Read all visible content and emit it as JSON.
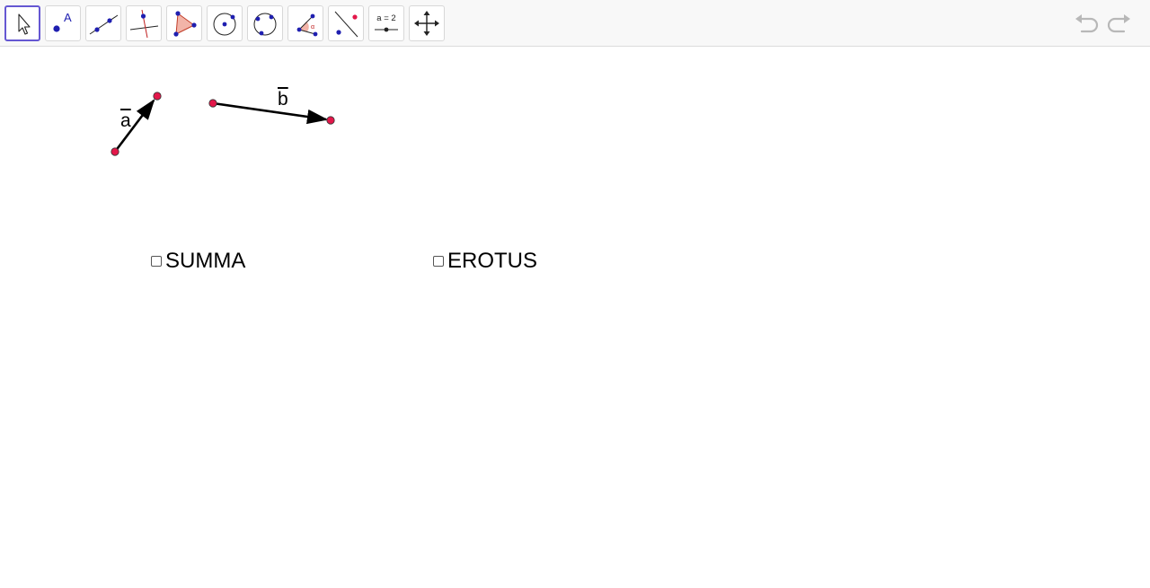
{
  "toolbar": {
    "tools": [
      {
        "name": "move-tool",
        "icon": "cursor-arrow-icon",
        "active": true
      },
      {
        "name": "point-tool",
        "icon": "point-icon",
        "active": false
      },
      {
        "name": "line-tool",
        "icon": "line-through-points-icon",
        "active": false
      },
      {
        "name": "perpendicular-tool",
        "icon": "perpendicular-line-icon",
        "active": false
      },
      {
        "name": "polygon-tool",
        "icon": "polygon-icon",
        "active": false
      },
      {
        "name": "circle-tool",
        "icon": "circle-center-point-icon",
        "active": false
      },
      {
        "name": "circle-three-points-tool",
        "icon": "circle-three-points-icon",
        "active": false
      },
      {
        "name": "angle-tool",
        "icon": "angle-icon",
        "active": false
      },
      {
        "name": "reflect-tool",
        "icon": "reflect-about-line-icon",
        "active": false
      },
      {
        "name": "slider-tool",
        "icon": "slider-icon",
        "active": false
      },
      {
        "name": "move-graphics-tool",
        "icon": "move-graphics-view-icon",
        "active": false
      }
    ],
    "point_icon_label": "A",
    "slider_icon_label": "a = 2",
    "undo_icon": "undo-icon",
    "redo_icon": "redo-icon"
  },
  "canvas": {
    "vector_a_label": "a",
    "vector_b_label": "b",
    "summa_label": "SUMMA",
    "erotus_label": "EROTUS",
    "summa_checked": false,
    "erotus_checked": false
  },
  "colors": {
    "accent": "#6557d2",
    "point_fill": "#e3174a",
    "icon_blue": "#1f1fb0",
    "toolbar_bg": "#f8f8f8"
  }
}
